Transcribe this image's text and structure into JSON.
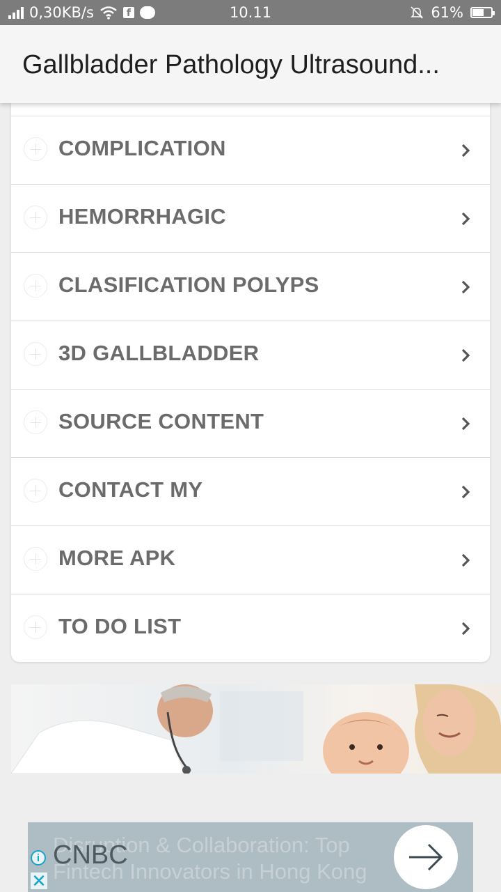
{
  "status_bar": {
    "speed": "0,30KB/s",
    "time": "10.11",
    "battery": "61%",
    "battery_level": 0.61
  },
  "app_bar": {
    "title": "Gallbladder Pathology Ultrasound..."
  },
  "menu": {
    "items": [
      {
        "label": "COMPLICATION"
      },
      {
        "label": "HEMORRHAGIC"
      },
      {
        "label": "CLASIFICATION POLYPS"
      },
      {
        "label": "3D GALLBLADDER"
      },
      {
        "label": "SOURCE CONTENT"
      },
      {
        "label": "CONTACT MY"
      },
      {
        "label": "MORE APK"
      },
      {
        "label": "TO DO LIST"
      }
    ]
  },
  "ad": {
    "brand": "CNBC",
    "text": "Disruption & Collaboration: Top Fintech Innovators in Hong Kong"
  }
}
